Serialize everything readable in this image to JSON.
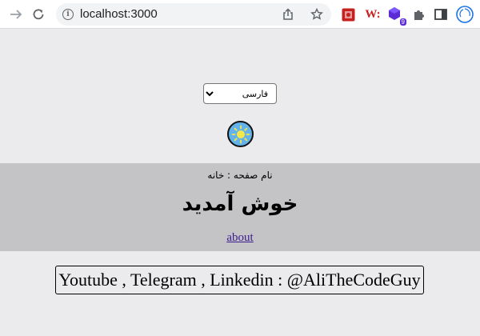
{
  "browser": {
    "url": "localhost:3000",
    "extensions": [
      {
        "name": "red-square-extension-icon",
        "color": "#c5221f"
      },
      {
        "name": "w-extension-icon",
        "label": "W:",
        "color": "#c5221f"
      },
      {
        "name": "purple-cube-extension-icon",
        "badge": "9",
        "color": "#5b2bd6"
      },
      {
        "name": "puzzle-icon"
      },
      {
        "name": "sidebar-icon"
      },
      {
        "name": "profile-avatar"
      }
    ]
  },
  "page": {
    "language_selected": "فارسی",
    "theme_icon": "sun-icon",
    "page_name": "نام صفحه : خانه",
    "welcome": "خوش آمدید",
    "about_link": "about",
    "social": "Youtube , Telegram , Linkedin : @AliTheCodeGuy"
  },
  "colors": {
    "background": "#ebeaec",
    "band": "#c4c3c5",
    "toggle": "#63b3ea",
    "link": "#3b1d8f"
  }
}
